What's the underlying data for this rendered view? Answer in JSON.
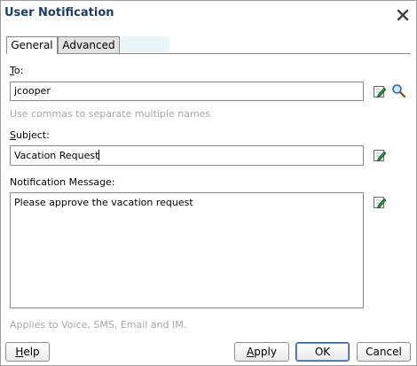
{
  "dialog": {
    "title": "User Notification"
  },
  "tabs": [
    {
      "label": "General",
      "active": true
    },
    {
      "label": "Advanced",
      "active": false
    }
  ],
  "to": {
    "label_mnemonic": "T",
    "label_rest": "o:",
    "value": "jcooper",
    "hint": "Use commas to separate multiple names"
  },
  "subject": {
    "label_mnemonic": "S",
    "label_rest": "ubject:",
    "value": "Vacation Request"
  },
  "message": {
    "label": "Notification Message:",
    "value": "Please approve the vacation request",
    "hint": "Applies to Voice, SMS, Email and IM."
  },
  "buttons": {
    "help_mnemonic": "H",
    "help_rest": "elp",
    "apply_mnemonic": "A",
    "apply_rest": "pply",
    "ok": "OK",
    "cancel": "Cancel"
  },
  "colors": {
    "title": "#1d3a6b",
    "hint": "#a6a6a6",
    "edit_icon": "#2e8b3a",
    "search_icon": "#2a64b8"
  },
  "icons": [
    "close-icon",
    "edit-icon",
    "search-icon"
  ]
}
